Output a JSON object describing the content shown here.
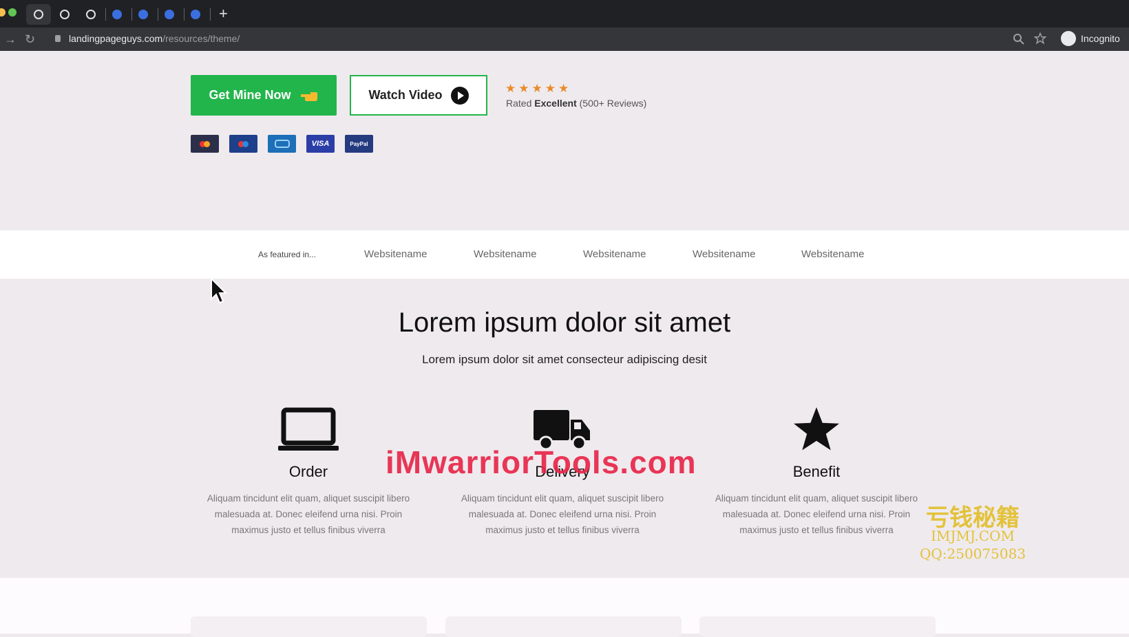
{
  "browser": {
    "url_domain": "landingpageguys.com",
    "url_path": "/resources/theme/",
    "incognito_label": "Incognito",
    "new_tab_icon": "+"
  },
  "hero": {
    "primary_button": "Get Mine Now",
    "primary_icon": "pointing-hand-icon",
    "secondary_button": "Watch Video",
    "stars": "★★★★★",
    "rated_prefix": "Rated",
    "rated_word": "Excellent",
    "rated_suffix": "(500+ Reviews)",
    "payment_cards": [
      {
        "name": "mastercard",
        "label": "MasterCard",
        "color": "#c0392b"
      },
      {
        "name": "maestro",
        "label": "Maestro",
        "color": "#1e3f8a"
      },
      {
        "name": "cirrus",
        "label": "Cirrus",
        "color": "#1d6fb8"
      },
      {
        "name": "visa",
        "label": "VISA",
        "color": "#2b3ea8"
      },
      {
        "name": "paypal",
        "label": "PayPal",
        "color": "#253b80"
      }
    ]
  },
  "featured": {
    "label": "As featured in...",
    "sites": [
      "Websitename",
      "Websitename",
      "Websitename",
      "Websitename",
      "Websitename"
    ]
  },
  "features": {
    "heading": "Lorem ipsum dolor sit amet",
    "subheading": "Lorem ipsum dolor sit amet consecteur adipiscing desit",
    "items": [
      {
        "title": "Order",
        "icon": "laptop-icon",
        "text": "Aliquam tincidunt elit quam, aliquet suscipit libero malesuada at. Donec eleifend urna nisi. Proin maximus justo et tellus finibus viverra"
      },
      {
        "title": "Delivery",
        "icon": "truck-icon",
        "text": "Aliquam tincidunt elit quam, aliquet suscipit libero malesuada at. Donec eleifend urna nisi. Proin maximus justo et tellus finibus viverra"
      },
      {
        "title": "Benefit",
        "icon": "star-icon",
        "text": "Aliquam tincidunt elit quam, aliquet suscipit libero malesuada at. Donec eleifend urna nisi. Proin maximus justo et tellus finibus viverra"
      }
    ]
  },
  "watermarks": {
    "main": "iMwarriorTools.com",
    "cn_title": "亏钱秘籍",
    "cn_site": "IMJMJ.COM",
    "cn_qq": "QQ:250075083"
  },
  "colors": {
    "accent_green": "#22b54c",
    "star_orange": "#e98b2a"
  }
}
